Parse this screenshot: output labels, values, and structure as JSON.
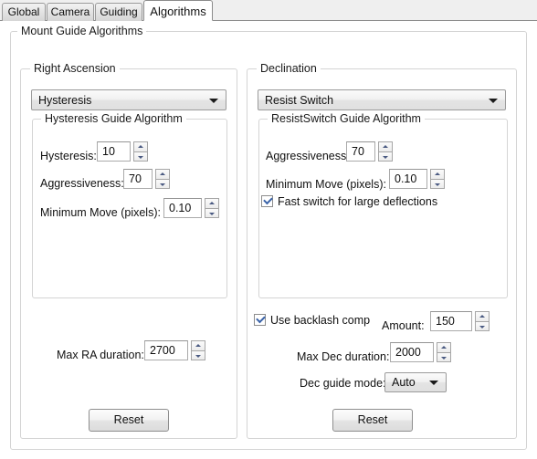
{
  "tabs": [
    {
      "label": "Global",
      "active": false
    },
    {
      "label": "Camera",
      "active": false
    },
    {
      "label": "Guiding",
      "active": false
    },
    {
      "label": "Algorithms",
      "active": true
    }
  ],
  "outer_group": {
    "title": "Mount Guide Algorithms"
  },
  "right_ascension": {
    "title": "Right Ascension",
    "algorithm_combo": {
      "value": "Hysteresis",
      "arrow_icon": "chevron-down-icon"
    },
    "inner_title": "Hysteresis Guide Algorithm",
    "fields": [
      {
        "label": "Hysteresis:",
        "value": "10"
      },
      {
        "label": "Aggressiveness:",
        "value": "70"
      },
      {
        "label": "Minimum Move (pixels):",
        "value": "0.10"
      }
    ],
    "max_duration": {
      "label": "Max RA duration:",
      "value": "2700"
    },
    "reset_label": "Reset"
  },
  "declination": {
    "title": "Declination",
    "algorithm_combo": {
      "value": "Resist Switch",
      "arrow_icon": "chevron-down-icon"
    },
    "inner_title": "ResistSwitch Guide Algorithm",
    "fields": [
      {
        "label": "Aggressiveness:",
        "value": "70"
      },
      {
        "label": "Minimum Move (pixels):",
        "value": "0.10"
      }
    ],
    "fast_switch": {
      "label": "Fast switch for large deflections",
      "checked": true
    },
    "backlash": {
      "label": "Use backlash comp",
      "checked": true
    },
    "amount": {
      "label": "Amount:",
      "value": "150"
    },
    "max_dec_duration": {
      "label": "Max Dec duration:",
      "value": "2000"
    },
    "dec_guide_mode": {
      "label": "Dec guide mode:",
      "value": "Auto",
      "arrow_icon": "chevron-down-icon"
    },
    "reset_label": "Reset"
  },
  "colors": {
    "tab_active_bg": "#ffffff",
    "tab_inactive_bg": "#e3e3e3",
    "strip_bg": "#efefef",
    "group_border": "#d4d4d4",
    "spinner_arrow": "#4a5a82",
    "check_color": "#3a63a8"
  }
}
